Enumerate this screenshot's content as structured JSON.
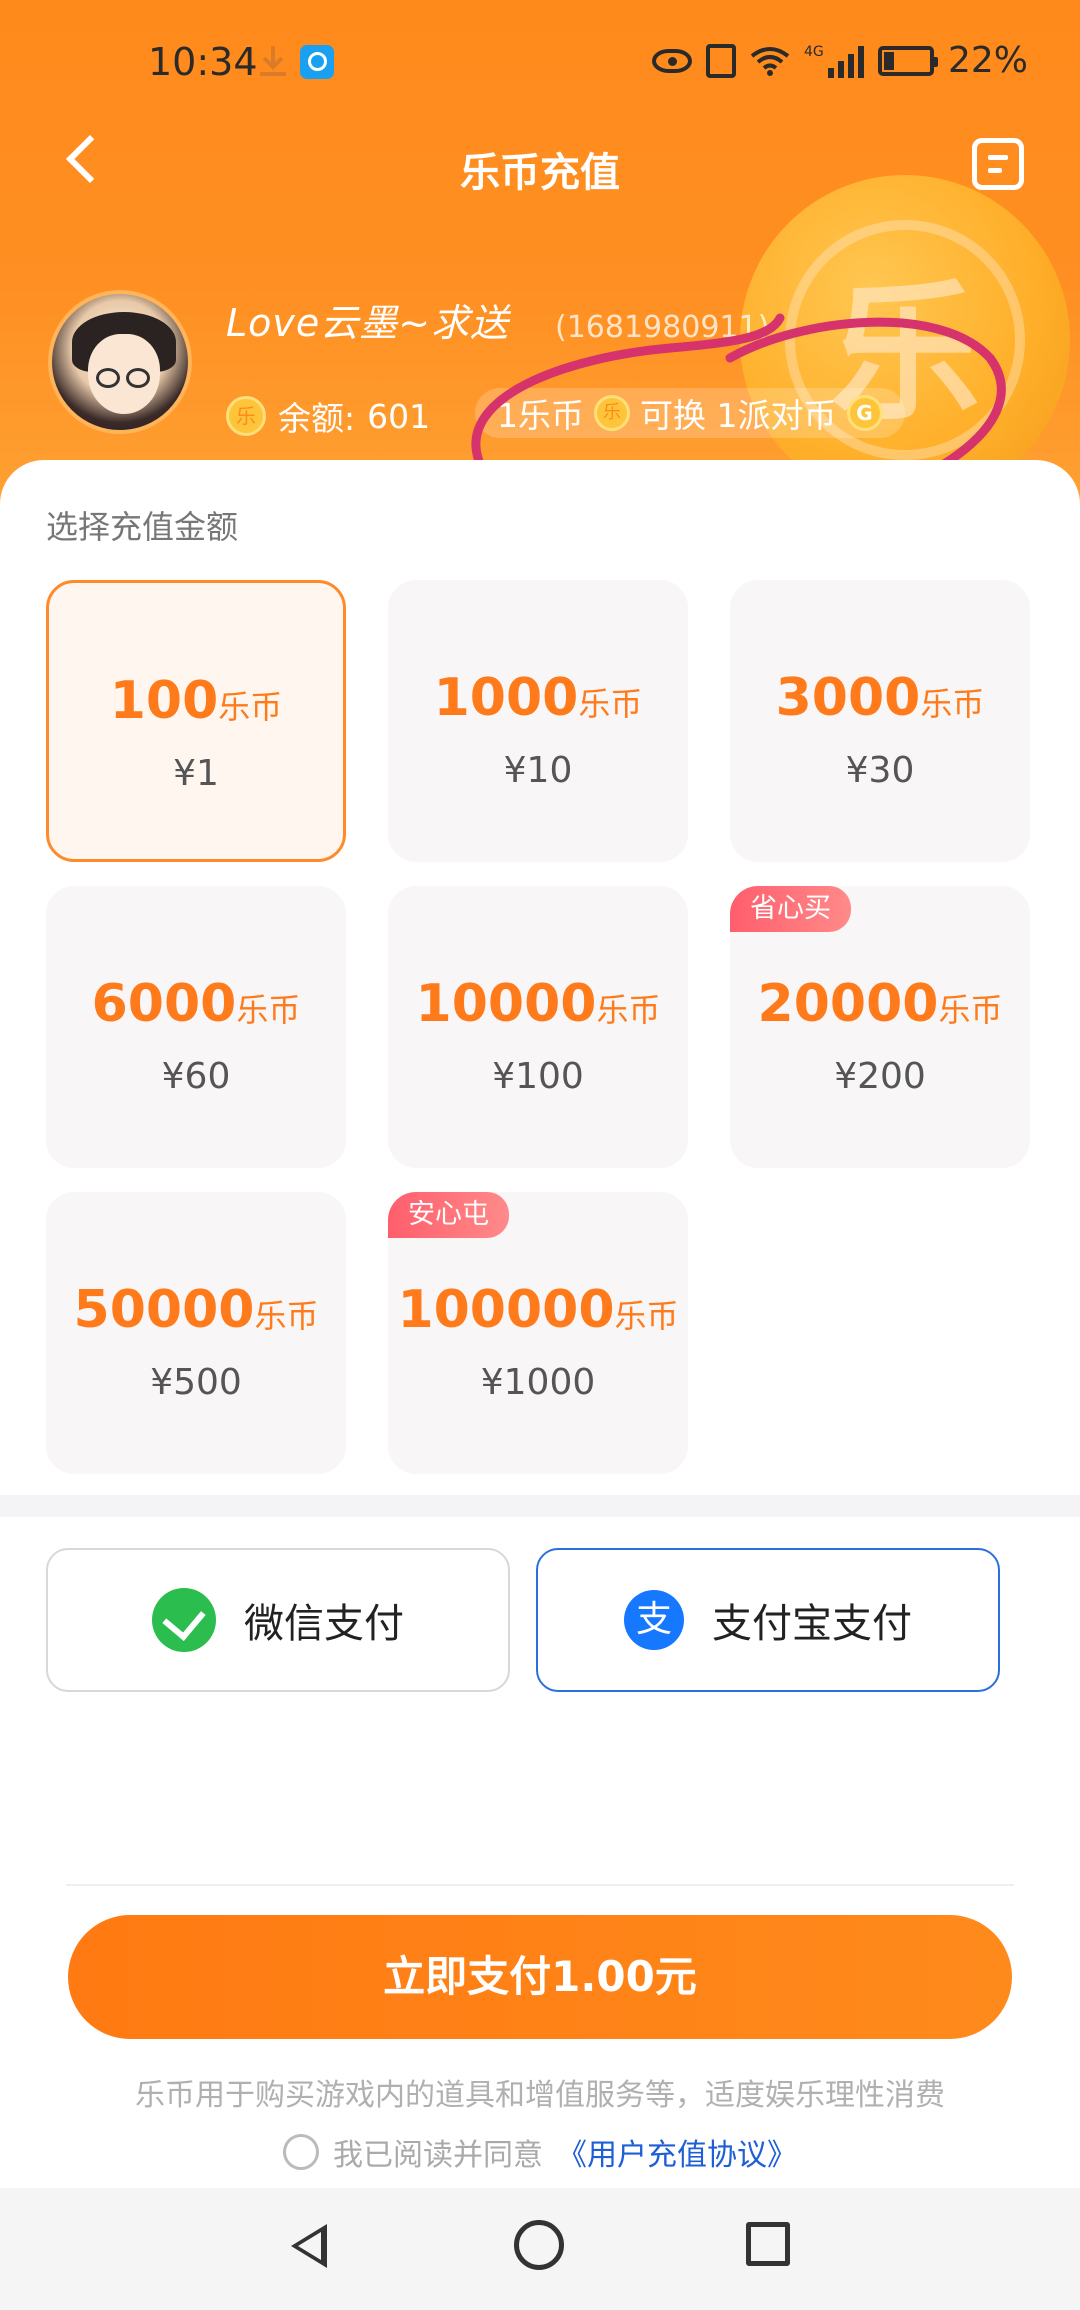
{
  "status_bar": {
    "time": "10:34",
    "network": "4G",
    "battery": "22%"
  },
  "header": {
    "title": "乐币充值",
    "username": "Love云墨~求送",
    "user_id": "(1681980911)",
    "balance_label": "余额:",
    "balance_value": "601",
    "rate_left": "1乐币",
    "rate_right": "可换 1派对币",
    "coin_glyph": "乐",
    "accent_color": "#ff8a1c",
    "annotation_color": "#d6336c"
  },
  "packages": {
    "section_label": "选择充值金额",
    "unit": "乐币",
    "items": [
      {
        "amount": "100",
        "price": "¥1",
        "selected": true
      },
      {
        "amount": "1000",
        "price": "¥10"
      },
      {
        "amount": "3000",
        "price": "¥30"
      },
      {
        "amount": "6000",
        "price": "¥60"
      },
      {
        "amount": "10000",
        "price": "¥100"
      },
      {
        "amount": "20000",
        "price": "¥200",
        "badge": "省心买"
      },
      {
        "amount": "50000",
        "price": "¥500"
      },
      {
        "amount": "100000",
        "price": "¥1000",
        "badge": "安心屯"
      }
    ]
  },
  "payment": {
    "wechat_label": "微信支付",
    "alipay_label": "支付宝支付",
    "alipay_glyph": "支",
    "selected": "alipay"
  },
  "footer": {
    "confirm_label": "立即支付1.00元",
    "notice": "乐币用于购买游戏内的道具和增值服务等，适度娱乐理性消费",
    "agree_text": "我已阅读并同意",
    "agreement_link": "《用户充值协议》"
  }
}
